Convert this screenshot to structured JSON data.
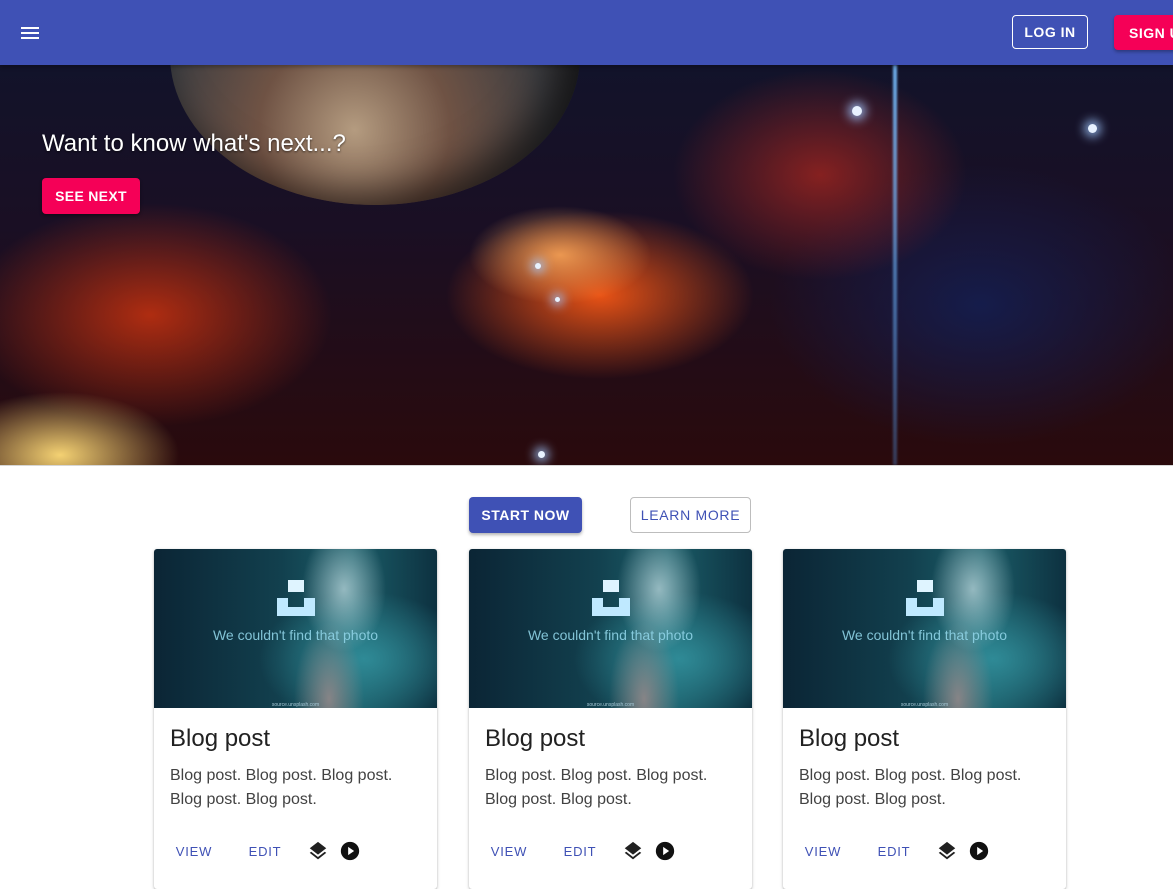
{
  "appbar": {
    "menu_icon": "menu-icon",
    "login_label": "LOG IN",
    "signup_label": "SIGN UP",
    "background_color": "#3f51b5",
    "accent_color": "#f50057"
  },
  "hero": {
    "heading": "Want to know what's next...?",
    "button_label": "SEE NEXT"
  },
  "actions": {
    "start_label": "START NOW",
    "learn_label": "LEARN MORE"
  },
  "cards": [
    {
      "image_text": "We couldn't find that photo",
      "image_source": "source.unsplash.com",
      "title": "Blog post",
      "body": "Blog post. Blog post. Blog post. Blog post. Blog post.",
      "view_label": "VIEW",
      "edit_label": "EDIT",
      "icons": [
        "layers-icon",
        "play-circle-icon"
      ]
    },
    {
      "image_text": "We couldn't find that photo",
      "image_source": "source.unsplash.com",
      "title": "Blog post",
      "body": "Blog post. Blog post. Blog post. Blog post. Blog post.",
      "view_label": "VIEW",
      "edit_label": "EDIT",
      "icons": [
        "layers-icon",
        "play-circle-icon"
      ]
    },
    {
      "image_text": "We couldn't find that photo",
      "image_source": "source.unsplash.com",
      "title": "Blog post",
      "body": "Blog post. Blog post. Blog post. Blog post. Blog post.",
      "view_label": "VIEW",
      "edit_label": "EDIT",
      "icons": [
        "layers-icon",
        "play-circle-icon"
      ]
    }
  ]
}
